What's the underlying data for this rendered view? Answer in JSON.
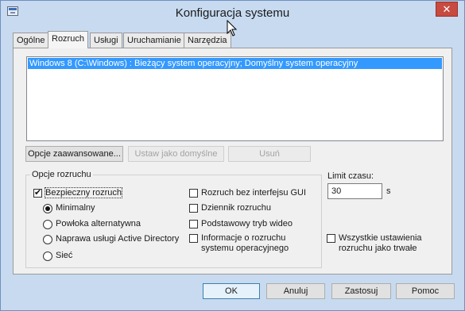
{
  "window": {
    "title": "Konfiguracja systemu"
  },
  "tabs": [
    {
      "label": "Ogólne"
    },
    {
      "label": "Rozruch"
    },
    {
      "label": "Usługi"
    },
    {
      "label": "Uruchamianie"
    },
    {
      "label": "Narzędzia"
    }
  ],
  "os_list": {
    "items": [
      "Windows 8 (C:\\Windows) : Bieżący system operacyjny; Domyślny system operacyjny"
    ]
  },
  "boot_buttons": {
    "advanced": "Opcje zaawansowane...",
    "set_default": "Ustaw jako domyślne",
    "delete": "Usuń"
  },
  "boot_options": {
    "label": "Opcje rozruchu",
    "safe_boot": {
      "label": "Bezpieczny rozruch",
      "checked": true
    },
    "radios": [
      {
        "label": "Minimalny",
        "checked": true
      },
      {
        "label": "Powłoka alternatywna",
        "checked": false
      },
      {
        "label": "Naprawa usługi Active Directory",
        "checked": false
      },
      {
        "label": "Sieć",
        "checked": false
      }
    ],
    "no_gui": {
      "label": "Rozruch bez interfejsu GUI",
      "checked": false
    },
    "boot_log": {
      "label": "Dziennik rozruchu",
      "checked": false
    },
    "base_video": {
      "label": "Podstawowy tryb wideo",
      "checked": false
    },
    "os_info_line1": "Informacje o rozruchu",
    "os_info_line2": "systemu operacyjnego",
    "os_info_checked": false
  },
  "timeout": {
    "label": "Limit czasu:",
    "value": "30",
    "unit": "s"
  },
  "permanent": {
    "line1": "Wszystkie ustawienia",
    "line2": "rozruchu jako trwałe",
    "checked": false
  },
  "footer_buttons": {
    "ok": "OK",
    "cancel": "Anuluj",
    "apply": "Zastosuj",
    "help": "Pomoc"
  },
  "colors": {
    "title_bg": "#c7daf0",
    "selection": "#3399ff",
    "close": "#c74b40"
  },
  "icons": {
    "app": "msconfig-icon",
    "close": "close-icon",
    "cursor": "mouse-cursor-icon"
  }
}
